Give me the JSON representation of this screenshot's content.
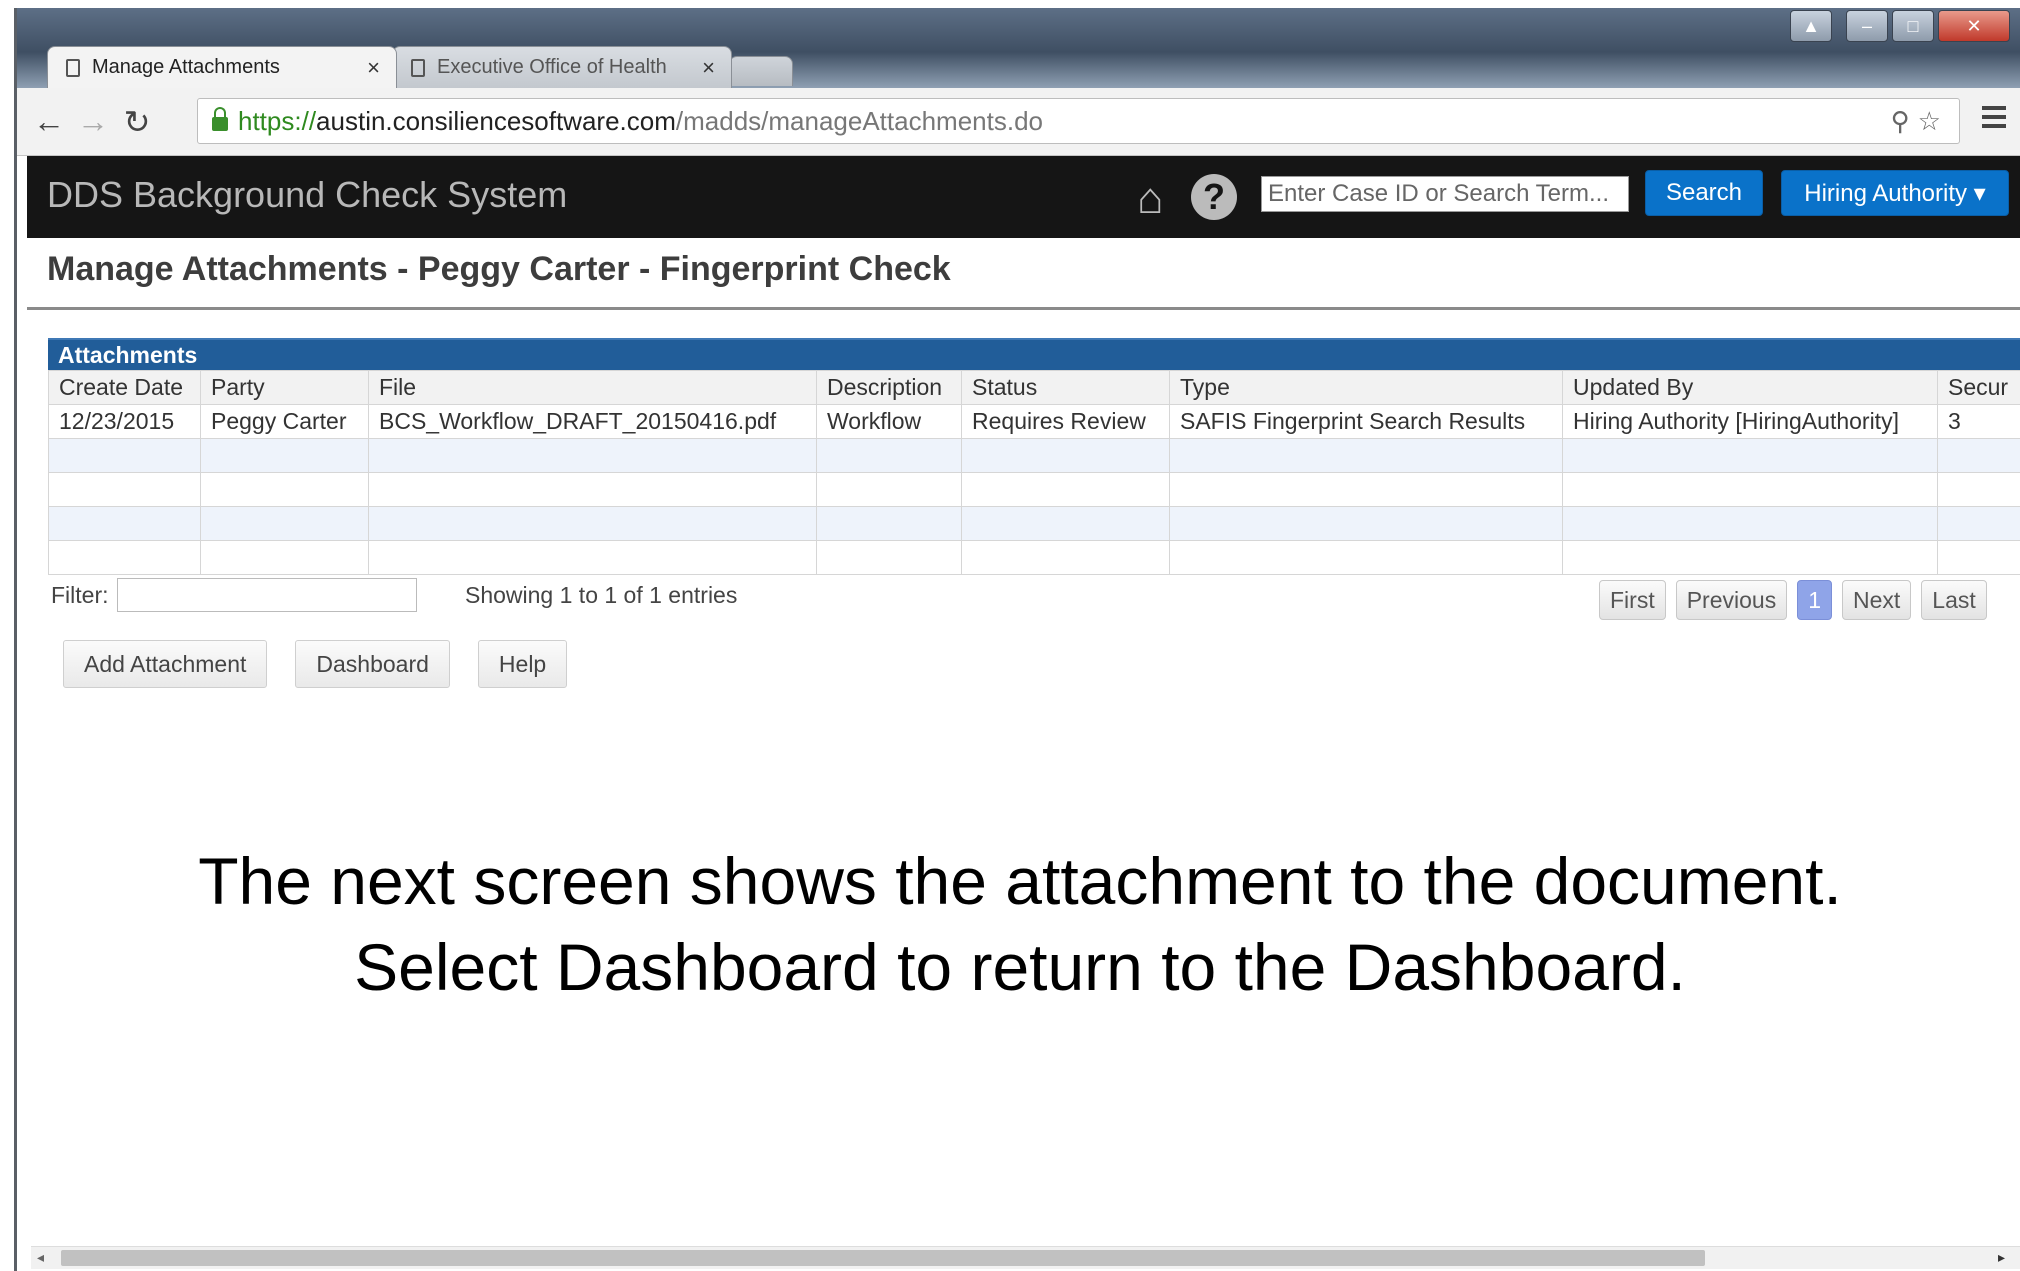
{
  "browser": {
    "tabs": [
      {
        "label": "Manage Attachments",
        "close": "×"
      },
      {
        "label": "Executive Office of Health",
        "close": "×"
      }
    ],
    "url": {
      "scheme": "https://",
      "host": "austin.consiliencesoftware.com",
      "path": "/madds/manageAttachments.do"
    },
    "window_controls": {
      "user": "▲",
      "minimize": "–",
      "maximize": "□",
      "close": "✕"
    }
  },
  "app": {
    "title": "DDS Background Check System",
    "search_placeholder": "Enter Case ID or Search Term...",
    "search_button": "Search",
    "role_menu": "Hiring Authority ▾"
  },
  "page": {
    "title": "Manage Attachments - Peggy Carter - Fingerprint Check"
  },
  "attachments": {
    "caption": "Attachments",
    "columns": [
      "Create Date",
      "Party",
      "File",
      "Description",
      "Status",
      "Type",
      "Updated By",
      "Secur"
    ],
    "rows": [
      [
        "12/23/2015",
        "Peggy Carter",
        "BCS_Workflow_DRAFT_20150416.pdf",
        "Workflow",
        "Requires Review",
        "SAFIS Fingerprint Search Results",
        "Hiring Authority [HiringAuthority]",
        "3"
      ]
    ],
    "filter_label": "Filter:",
    "showing": "Showing 1 to 1 of 1 entries",
    "pager": {
      "first": "First",
      "previous": "Previous",
      "current": "1",
      "next": "Next",
      "last": "Last"
    }
  },
  "actions": {
    "add_attachment": "Add Attachment",
    "dashboard": "Dashboard",
    "help": "Help"
  },
  "narration": {
    "line1": "The next screen shows the attachment to the document.",
    "line2": "Select Dashboard to return to the Dashboard."
  }
}
